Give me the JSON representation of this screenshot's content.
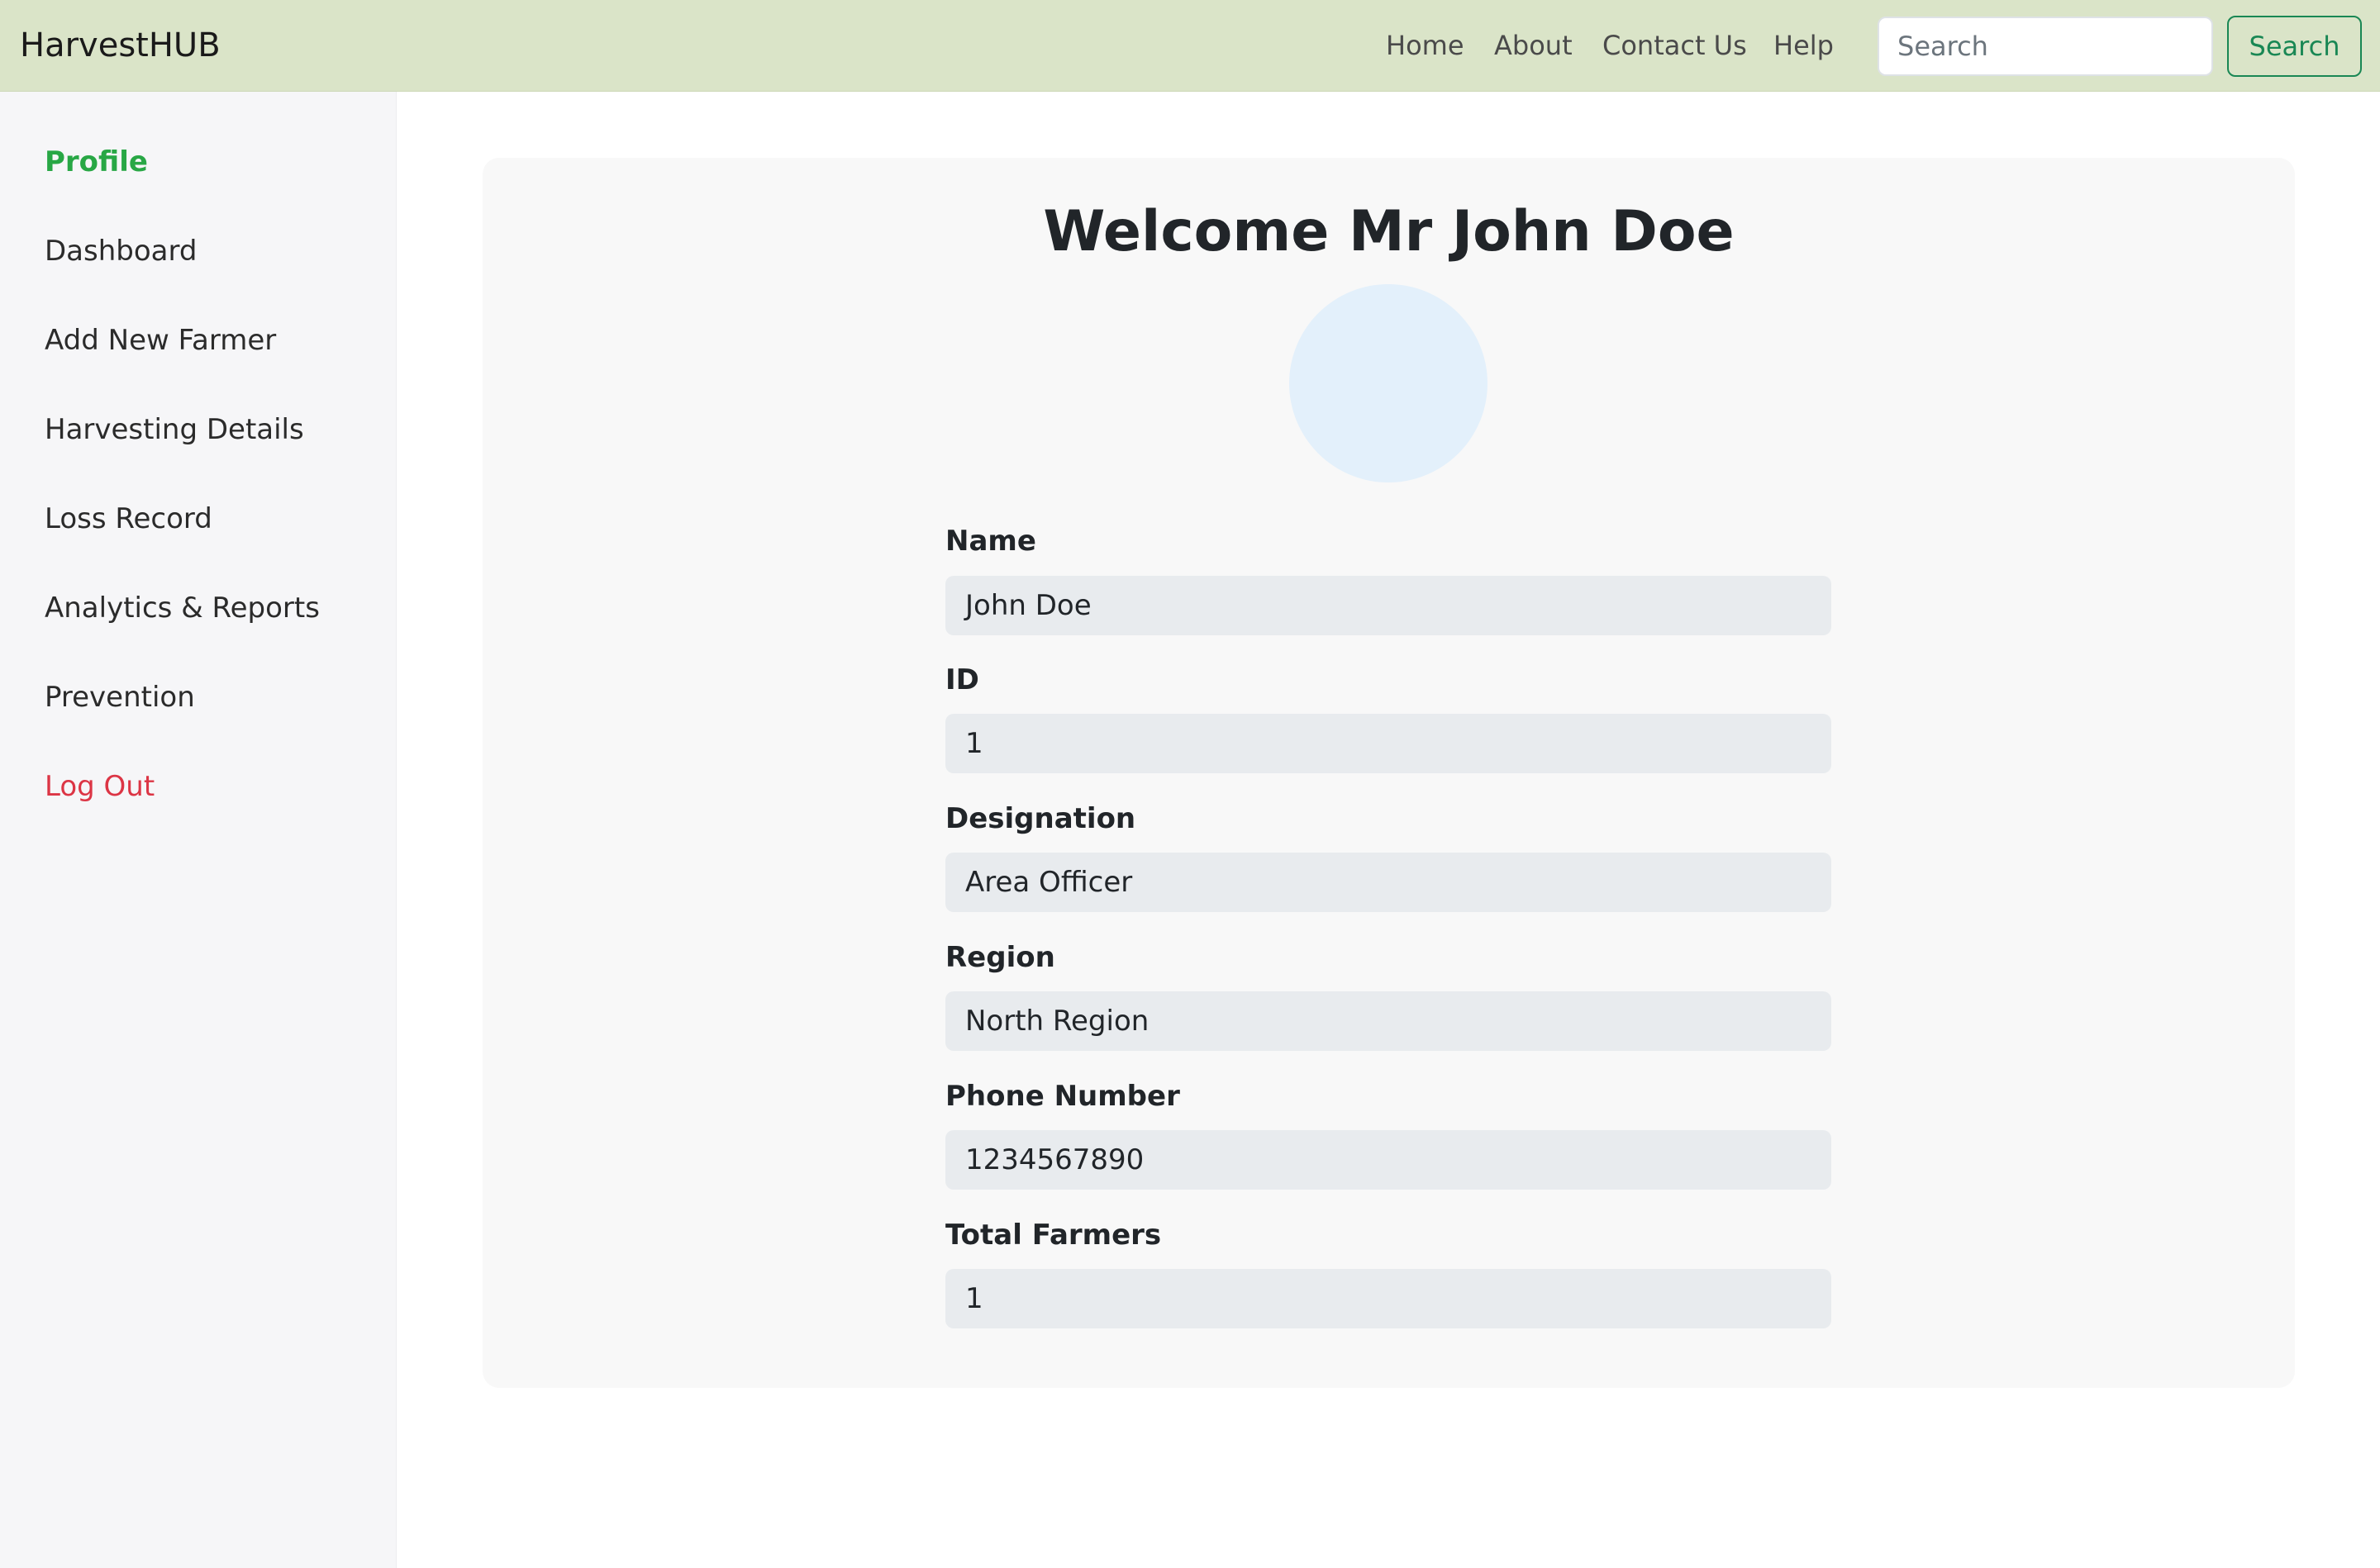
{
  "navbar": {
    "brand": "HarvestHUB",
    "links": [
      "Home",
      "About",
      "Contact Us",
      "Help"
    ],
    "search_placeholder": "Search",
    "search_button": "Search"
  },
  "sidebar": {
    "items": [
      {
        "label": "Profile",
        "state": "active"
      },
      {
        "label": "Dashboard"
      },
      {
        "label": "Add New Farmer"
      },
      {
        "label": "Harvesting Details"
      },
      {
        "label": "Loss Record"
      },
      {
        "label": "Analytics & Reports"
      },
      {
        "label": "Prevention"
      },
      {
        "label": "Log Out",
        "state": "danger"
      }
    ]
  },
  "profile": {
    "welcome": "Welcome Mr John Doe",
    "fields": [
      {
        "label": "Name",
        "value": "John Doe"
      },
      {
        "label": "ID",
        "value": "1"
      },
      {
        "label": "Designation",
        "value": "Area Officer"
      },
      {
        "label": "Region",
        "value": "North Region"
      },
      {
        "label": "Phone Number",
        "value": "1234567890"
      },
      {
        "label": "Total Farmers",
        "value": "1"
      }
    ]
  },
  "colors": {
    "navbar_bg": "#dae4c8",
    "accent_green": "#198754",
    "active_green": "#28a745",
    "logout_red": "#dc3545",
    "avatar_bg": "#e3f0fb"
  }
}
